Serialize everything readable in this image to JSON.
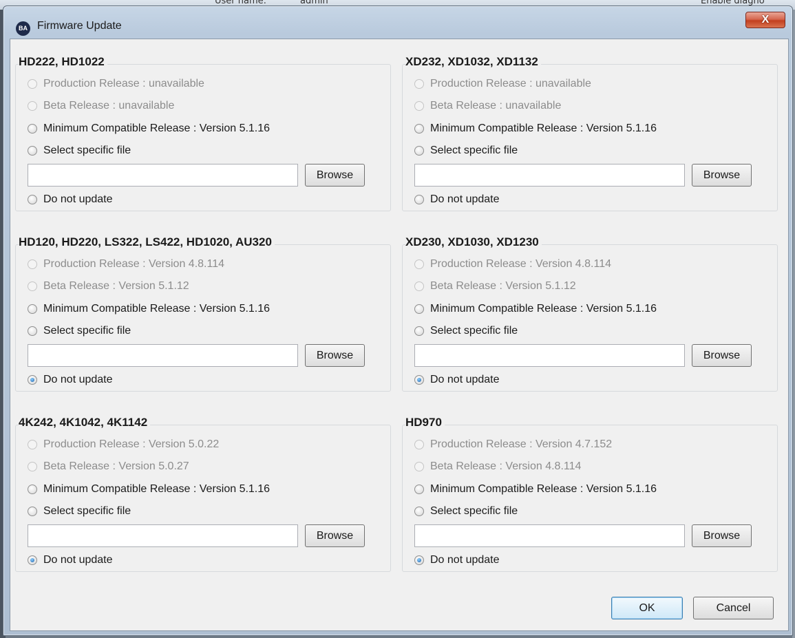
{
  "background": {
    "fragment_left": "User name:",
    "fragment_mid": "admin",
    "fragment_right": "Enable diagno"
  },
  "window": {
    "title": "Firmware Update",
    "icon_text": "BA",
    "close_label": "X"
  },
  "groups": [
    {
      "title": "HD222, HD1022",
      "options": [
        {
          "label": "Production Release : unavailable",
          "enabled": false,
          "checked": false
        },
        {
          "label": "Beta Release : unavailable",
          "enabled": false,
          "checked": false
        },
        {
          "label": "Minimum Compatible Release : Version 5.1.16",
          "enabled": true,
          "checked": false
        },
        {
          "label": "Select specific file",
          "enabled": true,
          "checked": false
        }
      ],
      "file_value": "",
      "browse_label": "Browse",
      "no_update": {
        "label": "Do not update",
        "checked": false
      }
    },
    {
      "title": "XD232, XD1032, XD1132",
      "options": [
        {
          "label": "Production Release : unavailable",
          "enabled": false,
          "checked": false
        },
        {
          "label": "Beta Release : unavailable",
          "enabled": false,
          "checked": false
        },
        {
          "label": "Minimum Compatible Release : Version 5.1.16",
          "enabled": true,
          "checked": false
        },
        {
          "label": "Select specific file",
          "enabled": true,
          "checked": false
        }
      ],
      "file_value": "",
      "browse_label": "Browse",
      "no_update": {
        "label": "Do not update",
        "checked": false
      }
    },
    {
      "title": "HD120, HD220, LS322, LS422, HD1020, AU320",
      "options": [
        {
          "label": "Production Release : Version 4.8.114",
          "enabled": false,
          "checked": false
        },
        {
          "label": "Beta Release : Version 5.1.12",
          "enabled": false,
          "checked": false
        },
        {
          "label": "Minimum Compatible Release : Version 5.1.16",
          "enabled": true,
          "checked": false
        },
        {
          "label": "Select specific file",
          "enabled": true,
          "checked": false
        }
      ],
      "file_value": "",
      "browse_label": "Browse",
      "no_update": {
        "label": "Do not update",
        "checked": true
      }
    },
    {
      "title": "XD230, XD1030, XD1230",
      "options": [
        {
          "label": "Production Release : Version 4.8.114",
          "enabled": false,
          "checked": false
        },
        {
          "label": "Beta Release : Version 5.1.12",
          "enabled": false,
          "checked": false
        },
        {
          "label": "Minimum Compatible Release : Version 5.1.16",
          "enabled": true,
          "checked": false
        },
        {
          "label": "Select specific file",
          "enabled": true,
          "checked": false
        }
      ],
      "file_value": "",
      "browse_label": "Browse",
      "no_update": {
        "label": "Do not update",
        "checked": true
      }
    },
    {
      "title": "4K242, 4K1042, 4K1142",
      "options": [
        {
          "label": "Production Release : Version 5.0.22",
          "enabled": false,
          "checked": false
        },
        {
          "label": "Beta Release : Version 5.0.27",
          "enabled": false,
          "checked": false
        },
        {
          "label": "Minimum Compatible Release : Version 5.1.16",
          "enabled": true,
          "checked": false
        },
        {
          "label": "Select specific file",
          "enabled": true,
          "checked": false
        }
      ],
      "file_value": "",
      "browse_label": "Browse",
      "no_update": {
        "label": "Do not update",
        "checked": true
      }
    },
    {
      "title": "HD970",
      "options": [
        {
          "label": "Production Release : Version 4.7.152",
          "enabled": false,
          "checked": false
        },
        {
          "label": "Beta Release : Version 4.8.114",
          "enabled": false,
          "checked": false
        },
        {
          "label": "Minimum Compatible Release : Version 5.1.16",
          "enabled": true,
          "checked": false
        },
        {
          "label": "Select specific file",
          "enabled": true,
          "checked": false
        }
      ],
      "file_value": "",
      "browse_label": "Browse",
      "no_update": {
        "label": "Do not update",
        "checked": true
      }
    }
  ],
  "footer": {
    "ok_label": "OK",
    "cancel_label": "Cancel"
  }
}
